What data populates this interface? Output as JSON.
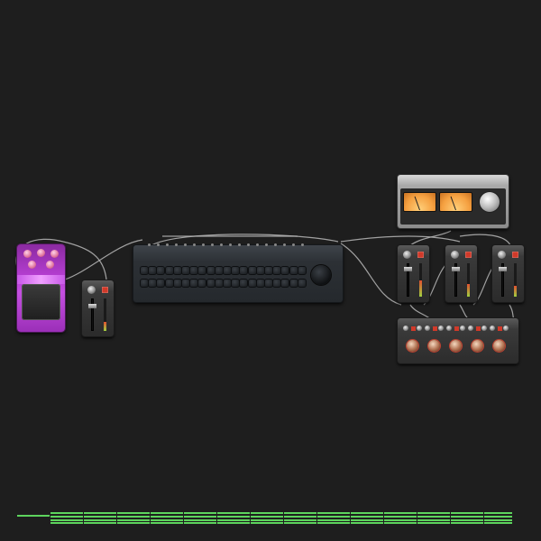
{
  "devices": {
    "pedal": {
      "name": ""
    },
    "strip_a": {
      "name": ""
    },
    "sequencer": {
      "name": "",
      "title": "",
      "subtitle": ""
    },
    "vu_meter": {
      "name": "",
      "brand": ""
    },
    "strip_b": {
      "name": ""
    },
    "strip_c": {
      "name": ""
    },
    "strip_d": {
      "name": ""
    },
    "eq_unit": {
      "name": ""
    }
  },
  "colors": {
    "background": "#1e1e1e",
    "cable": "#b8b8b8",
    "pedal_body": "#c44fe0",
    "vu_face": "#f5a040",
    "timeline_clip": "#5dd45d",
    "accent_red": "#d03a2a"
  },
  "icons": {
    "knob": "rotary-knob-icon",
    "fader": "fader-icon",
    "port": "cable-port-icon"
  }
}
